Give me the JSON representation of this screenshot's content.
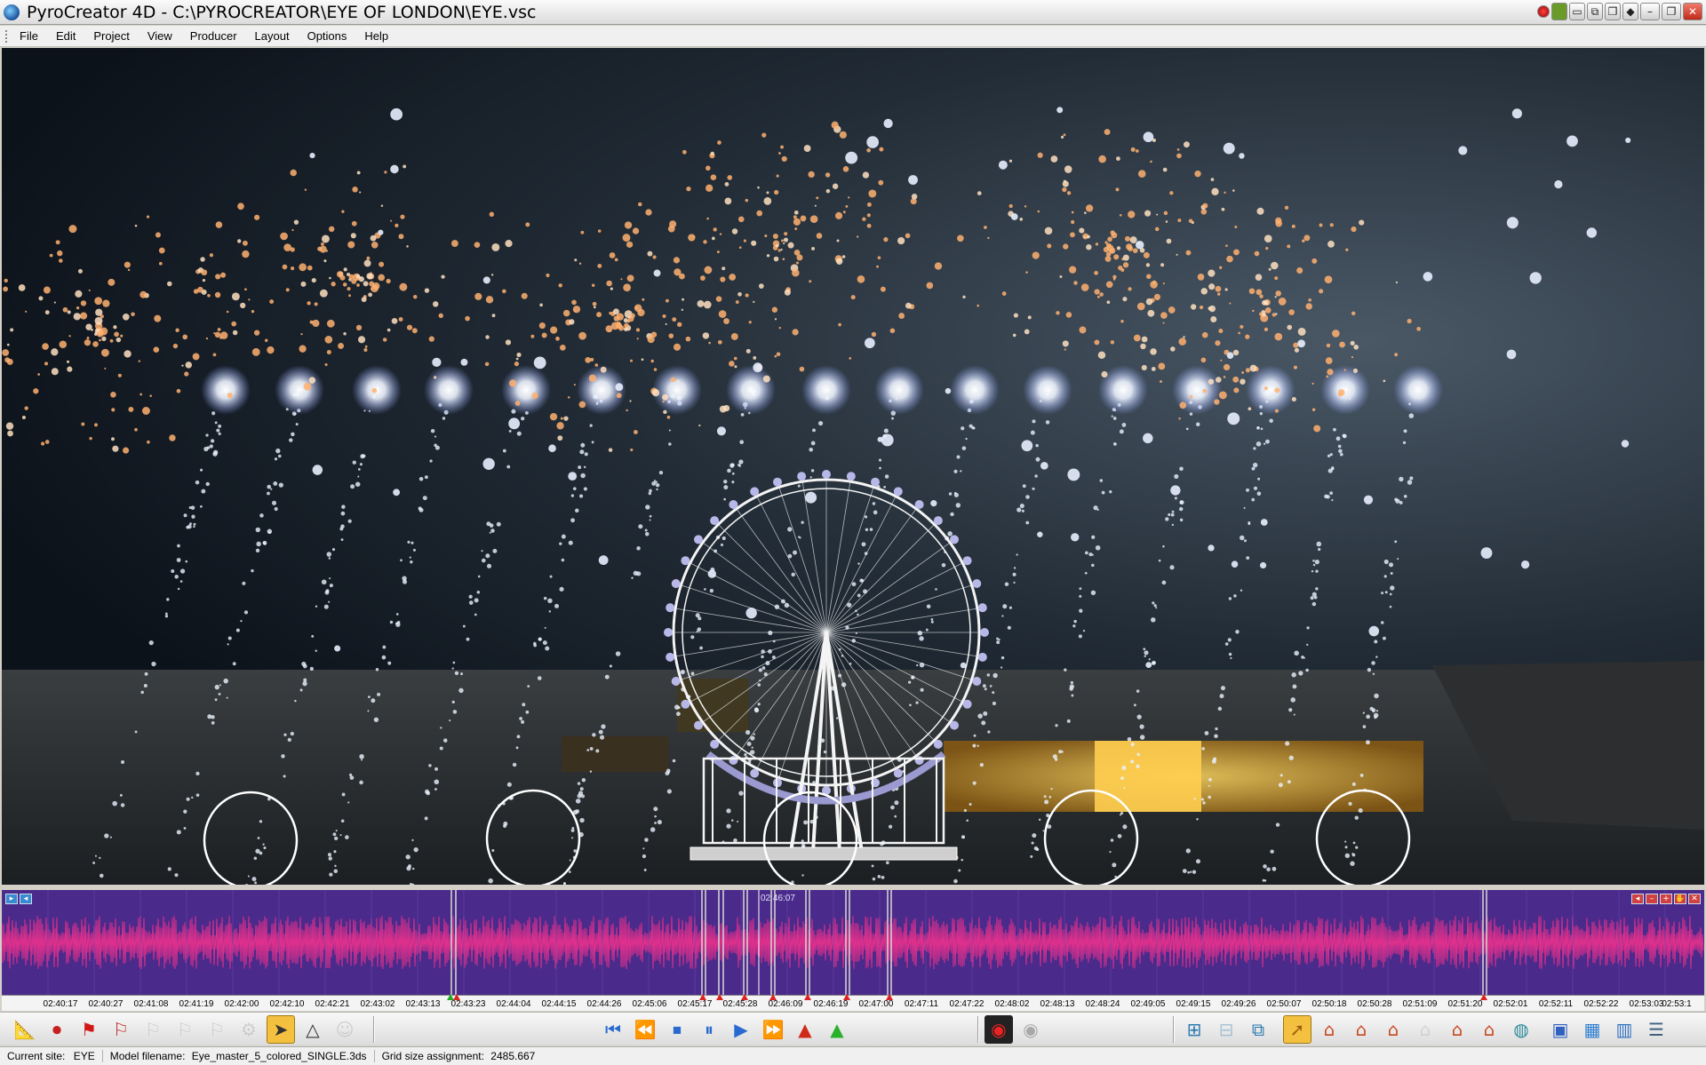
{
  "window": {
    "title": "PyroCreator 4D - C:\\PYROCREATOR\\EYE OF LONDON\\EYE.vsc"
  },
  "menu": [
    "File",
    "Edit",
    "Project",
    "View",
    "Producer",
    "Layout",
    "Options",
    "Help"
  ],
  "timeline": {
    "playhead_time": "02:46:07",
    "ticks": [
      "02:40:17",
      "02:40:27",
      "02:41:08",
      "02:41:19",
      "02:42:00",
      "02:42:10",
      "02:42:21",
      "02:43:02",
      "02:43:13",
      "02:43:23",
      "02:44:04",
      "02:44:15",
      "02:44:26",
      "02:45:06",
      "02:45:17",
      "02:45:28",
      "02:46:09",
      "02:46:19",
      "02:47:00",
      "02:47:11",
      "02:47:22",
      "02:48:02",
      "02:48:13",
      "02:48:24",
      "02:49:05",
      "02:49:15",
      "02:49:26",
      "02:50:07",
      "02:50:18",
      "02:50:28",
      "02:51:09",
      "02:51:20",
      "02:52:01",
      "02:52:11",
      "02:52:22",
      "02:53:03",
      "02:53:1"
    ],
    "colors": {
      "background": "#4a2a8a",
      "wave": "#e8308c",
      "cue": "#d0d0d0"
    }
  },
  "toolbar": {
    "left_tools": [
      "ruler-pen-icon",
      "record-icon",
      "red-flag-icon",
      "flag-a-icon",
      "grey-flag-icon",
      "grey-flag2-icon",
      "grey-flag3-icon",
      "cog-icon",
      "select-tool-icon",
      "triangle-tool-icon",
      "person-icon"
    ],
    "transport": [
      "skip-start-icon",
      "rewind-icon",
      "stop-icon",
      "pause-icon",
      "play-icon",
      "fast-forward-icon",
      "warning-red-icon",
      "warning-green-icon"
    ],
    "right_tools": [
      "network-icon",
      "network2-icon",
      "layers-icon",
      "cursor-icon",
      "house-icon",
      "house-arrow-icon",
      "house-x-icon",
      "house-grey-icon",
      "house-add-icon",
      "house-tree-icon",
      "globe-icon",
      "image-icon",
      "palette-icon",
      "grid-icon",
      "list-icon"
    ]
  },
  "status": {
    "site_label": "Current site:",
    "site_value": "EYE",
    "model_label": "Model filename:",
    "model_value": "Eye_master_5_colored_SINGLE.3ds",
    "grid_label": "Grid size assignment:",
    "grid_value": "2485.667"
  }
}
